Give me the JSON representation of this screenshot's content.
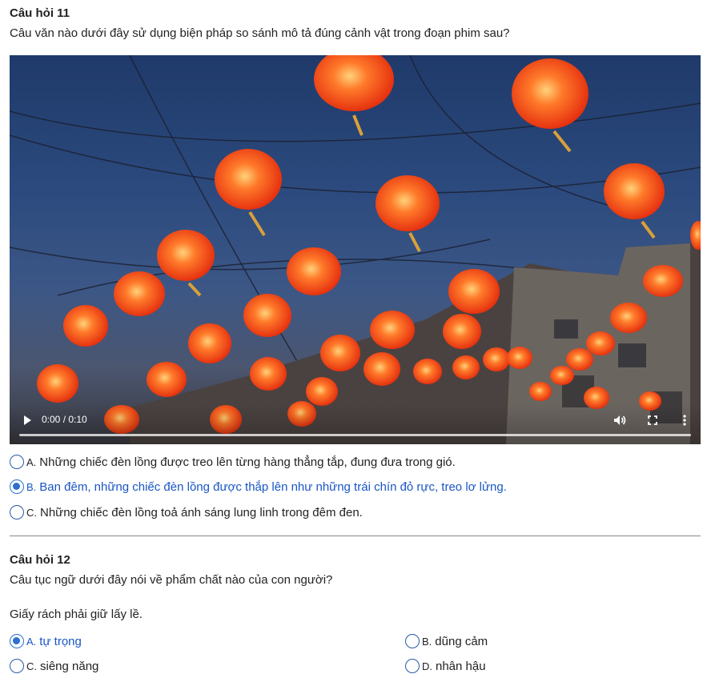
{
  "q11": {
    "title": "Câu hỏi 11",
    "question": "Câu văn nào dưới đây sử dụng biện pháp so sánh mô tả đúng cảnh vật trong đoạn phim sau?",
    "video": {
      "time": "0:00 / 0:10",
      "progress": 0
    },
    "options": [
      {
        "letter": "A.",
        "text": "Những chiếc đèn lồng được treo lên từng hàng thẳng tắp, đung đưa trong gió.",
        "selected": false
      },
      {
        "letter": "B.",
        "text": "Ban đêm, những chiếc đèn lồng được thắp lên như những trái chín đỏ rực, treo lơ lửng.",
        "selected": true
      },
      {
        "letter": "C.",
        "text": "Những chiếc đèn lồng toả ánh sáng lung linh trong đêm đen.",
        "selected": false
      }
    ]
  },
  "q12": {
    "title": "Câu hỏi 12",
    "question": "Câu tục ngữ dưới đây nói về phẩm chất nào của con người?",
    "proverb": "Giấy rách phải giữ lấy lề.",
    "options": [
      {
        "letter": "A.",
        "text": "tự trọng",
        "selected": true
      },
      {
        "letter": "B.",
        "text": "dũng cảm",
        "selected": false
      },
      {
        "letter": "C.",
        "text": "siêng năng",
        "selected": false
      },
      {
        "letter": "D.",
        "text": "nhân hậu",
        "selected": false
      }
    ]
  },
  "colors": {
    "accent": "#2b6fd1",
    "selected_text": "#1a56c4",
    "lantern": "#ff4a1a"
  }
}
